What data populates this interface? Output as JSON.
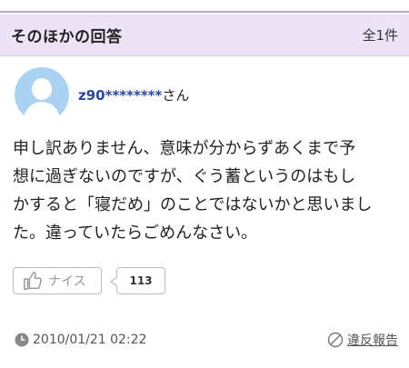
{
  "section": {
    "title": "そのほかの回答",
    "count": "全1件"
  },
  "answer": {
    "user_id": "z90********",
    "honorific": "さん",
    "lines": [
      "申し訳ありません、意味が分からずあくまで予",
      "想に過ぎないのですが、ぐう蓄というのはもし",
      "かすると「寝だめ」のことではないかと思いまし",
      "た。違っていたらごめんなさい。"
    ]
  },
  "reaction": {
    "nice_label": "ナイス",
    "count": "113"
  },
  "footer": {
    "timestamp": "2010/01/21 02:22",
    "report_label": "違反報告"
  },
  "colors": {
    "header_bg": "#ede3f6",
    "accent_border": "#b9a3d6",
    "user_link": "#2946a3",
    "avatar_bg": "#a9d2f3"
  },
  "icons": {
    "avatar": "default-user-avatar",
    "nice": "thumbs-up-icon",
    "clock": "clock-icon",
    "report": "prohibited-icon"
  }
}
